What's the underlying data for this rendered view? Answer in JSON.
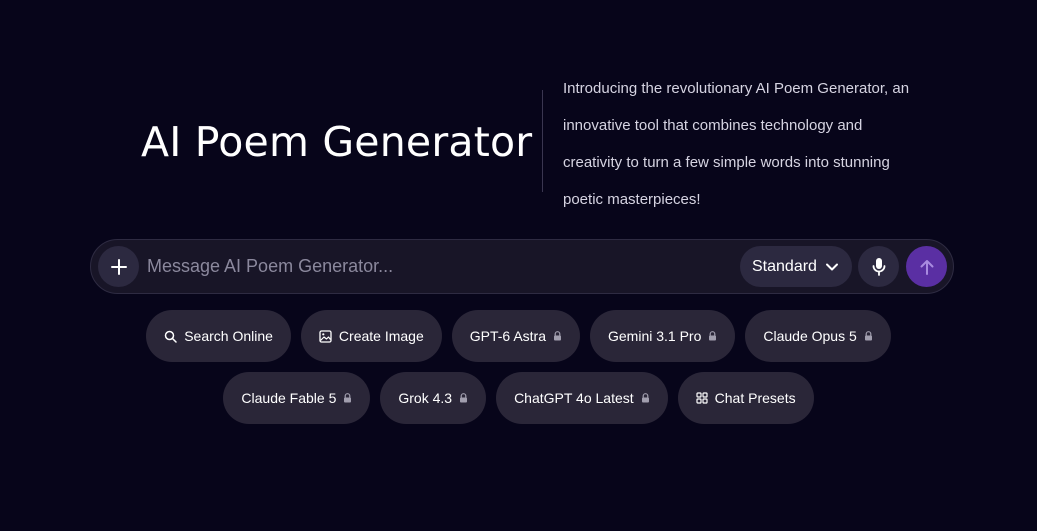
{
  "hero": {
    "title": "AI Poem Generator",
    "intro": "Introducing the revolutionary AI Poem Generator, an innovative tool that combines technology and creativity to turn a few simple words into stunning poetic masterpieces!"
  },
  "composer": {
    "placeholder": "Message AI Poem Generator...",
    "value": "",
    "mode_label": "Standard",
    "icons": {
      "add": "plus-icon",
      "mode": "chevron-down-icon",
      "mic": "microphone-icon",
      "send": "arrow-up-icon"
    }
  },
  "chips": {
    "row1": [
      {
        "label": "Search Online",
        "icon": "search-icon"
      },
      {
        "label": "Create Image",
        "icon": "image-icon"
      },
      {
        "label": "GPT-6 Astra",
        "icon": "lock-icon"
      },
      {
        "label": "Gemini 3.1 Pro",
        "icon": "lock-icon"
      },
      {
        "label": "Claude Opus 5",
        "icon": "lock-icon"
      }
    ],
    "row2": [
      {
        "label": "Claude Fable 5",
        "icon": "lock-icon"
      },
      {
        "label": "Grok 4.3",
        "icon": "lock-icon"
      },
      {
        "label": "ChatGPT 4o Latest",
        "icon": "lock-icon"
      },
      {
        "label": "Chat Presets",
        "icon": "grid-icon"
      }
    ]
  },
  "colors": {
    "background": "#07051a",
    "surface": "#181527",
    "chip": "#2a2638",
    "accent": "#5a2fa3"
  }
}
